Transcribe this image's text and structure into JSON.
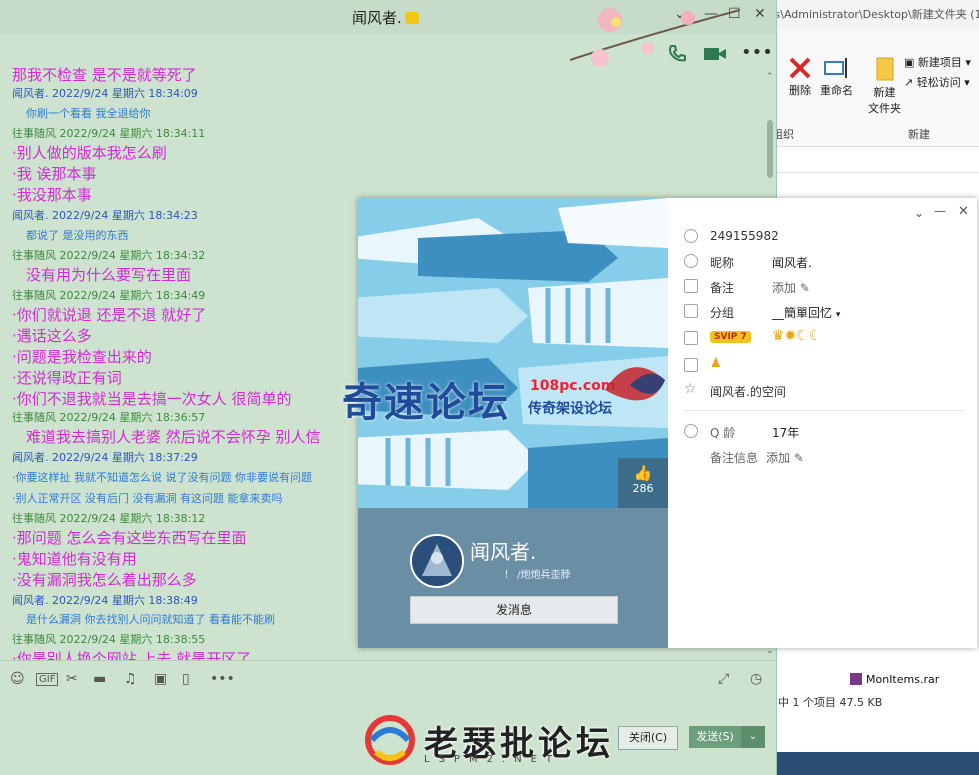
{
  "explorer": {
    "path": "rs\\Administrator\\Desktop\\新建文件夹 (1",
    "ribbon": {
      "delete": "删除",
      "rename": "重命名",
      "new_folder_1": "新建",
      "new_folder_2": "文件夹",
      "new_item": "新建项目",
      "easy_access": "轻松访问",
      "group_organize": "组织",
      "group_new": "新建"
    },
    "file_name": "MonItems.rar",
    "status": "中 1 个项目   47.5 KB"
  },
  "chat": {
    "title": "闻风者.",
    "messages": [
      {
        "kind": "big",
        "text": "那我不检查  是不是就等死了"
      },
      {
        "kind": "header-blue",
        "text": "闻风者. 2022/9/24 星期六 18:34:09"
      },
      {
        "kind": "small",
        "text": "你刷一个看看 我全退给你"
      },
      {
        "kind": "header-green",
        "text": "往事随风 2022/9/24 星期六 18:34:11"
      },
      {
        "kind": "big",
        "text": "·别人做的版本我怎么刷"
      },
      {
        "kind": "big",
        "text": "·我  诶那本事"
      },
      {
        "kind": "big",
        "text": "·我没那本事"
      },
      {
        "kind": "header-blue",
        "text": "闻风者. 2022/9/24 星期六 18:34:23"
      },
      {
        "kind": "small",
        "text": "都说了 是没用的东西"
      },
      {
        "kind": "header-green",
        "text": "往事随风 2022/9/24 星期六 18:34:32"
      },
      {
        "kind": "big",
        "text": "没有用为什么要写在里面"
      },
      {
        "kind": "header-green",
        "text": "往事随风 2022/9/24 星期六 18:34:49"
      },
      {
        "kind": "big",
        "text": "·你们就说退  还是不退  就好了"
      },
      {
        "kind": "big",
        "text": "·遇话这么多"
      },
      {
        "kind": "big",
        "text": "·问题是我检查出来的"
      },
      {
        "kind": "big",
        "text": "·还说得政正有词"
      },
      {
        "kind": "big",
        "text": "·你们不退我就当是去搞一次女人  很简单的"
      },
      {
        "kind": "header-green",
        "text": "往事随风 2022/9/24 星期六 18:36:57"
      },
      {
        "kind": "big",
        "text": "难道我去搞别人老婆  然后说不会怀孕  别人信"
      },
      {
        "kind": "header-blue",
        "text": "闻风者. 2022/9/24 星期六 18:37:29"
      },
      {
        "kind": "small",
        "text": "·你要这样扯  我就不知道怎么说  说了没有问题  你非要说有问题"
      },
      {
        "kind": "small",
        "text": "·别人正常开区 没有后门 没有漏洞  有这问题 能拿来卖吗"
      },
      {
        "kind": "header-green",
        "text": "往事随风 2022/9/24 星期六 18:38:12"
      },
      {
        "kind": "big",
        "text": "·那问题    怎么会有这些东西写在里面"
      },
      {
        "kind": "big",
        "text": "·鬼知道他有没有用"
      },
      {
        "kind": "big",
        "text": "·没有漏洞我怎么着出那么多"
      },
      {
        "kind": "header-blue",
        "text": "闻风者. 2022/9/24 星期六 18:38:49"
      },
      {
        "kind": "small",
        "text": "是什么漏洞 你去找别人问问就知道了  看看能不能刷"
      },
      {
        "kind": "header-green",
        "text": "往事随风 2022/9/24 星期六 18:38:55"
      },
      {
        "kind": "big",
        "text": "·你是别人换个网站  上去  就是开区了"
      }
    ],
    "close_label": "关闭(C)",
    "send_label": "发送(S)"
  },
  "profile": {
    "likes": "286",
    "name": "闻风者.",
    "signature": "！ /炮炮兵歪脖",
    "message_button": "发消息",
    "qq": "249155982",
    "nickname_label": "昵称",
    "nickname": "闻风者.",
    "remark_label": "备注",
    "remark_add": "添加",
    "group_label": "分组",
    "group_value": "__簡單回忆",
    "vip_label": "SVIP 7",
    "space": "闻风者.的空间",
    "age_label": "Q 龄",
    "age_value": "17年",
    "remark_info_label": "备注信息",
    "remark_info_add": "添加"
  },
  "watermarks": {
    "top_main": "奇速论坛",
    "top_site": "108pc.com",
    "top_tag": "传奇架设论坛",
    "bottom_main": "老瑟批论坛",
    "bottom_sub": "LSPM2.NET"
  }
}
